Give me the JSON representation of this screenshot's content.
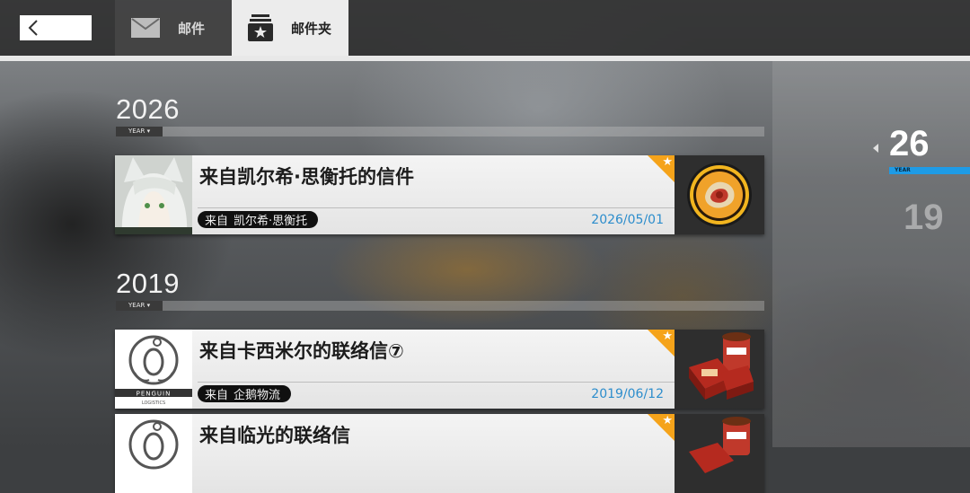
{
  "tabs": {
    "mail_label": "邮件",
    "folder_label": "邮件夹"
  },
  "groups": [
    {
      "year": "2026",
      "tag": "YEAR ▾"
    },
    {
      "year": "2019",
      "tag": "YEAR ▾"
    }
  ],
  "mails": [
    {
      "subject": "来自凯尔希·思衡托的信件",
      "from_prefix": "来自",
      "sender": "凯尔希·思衡托",
      "date": "2026/05/01"
    },
    {
      "subject": "来自卡西米尔的联络信⑦",
      "from_prefix": "来自",
      "sender": "企鹅物流",
      "date": "2019/06/12"
    },
    {
      "subject": "来自临光的联络信",
      "from_prefix": "来自",
      "sender": "",
      "date": ""
    }
  ],
  "penguin_logo_text": "PENGUIN",
  "penguin_logo_sub": "LOGISTICS",
  "year_nav": {
    "active": "26",
    "active_tag": "YEAR",
    "inactive": "19"
  },
  "icons": {
    "back": "chevron-left-icon",
    "mail": "envelope-icon",
    "folder": "star-folder-icon",
    "favorite": "star-icon"
  },
  "colors": {
    "accent_blue": "#1e9be6",
    "star_orange": "#f5a31a",
    "date_blue": "#2c8dcc"
  }
}
